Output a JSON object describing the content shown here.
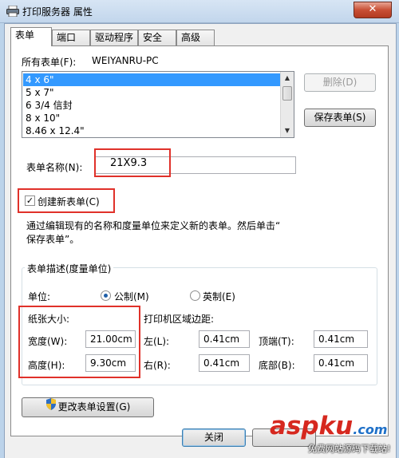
{
  "window": {
    "title": "打印服务器 属性",
    "close": "✕"
  },
  "tabs": [
    "表单",
    "端口",
    "驱动程序",
    "安全",
    "高级"
  ],
  "forms": {
    "all_forms_label": "所有表单(F):",
    "server_name": "WEIYANRU-PC",
    "list": [
      "4 x 6\"",
      "5 x 7\"",
      "6 3/4 信封",
      "8 x 10\"",
      "8.46 x 12.4\""
    ],
    "selected_index": 0
  },
  "buttons": {
    "delete": "删除(D)",
    "save_form": "保存表单(S)",
    "change_settings": "更改表单设置(G)",
    "close": "关闭"
  },
  "form_name": {
    "label": "表单名称(N):",
    "value": "21X9.3"
  },
  "create_new": {
    "label": "创建新表单(C)",
    "checked": true,
    "mark": "✓"
  },
  "instruction": "通过编辑现有的名称和度量单位来定义新的表单。然后单击“\n保存表单”。",
  "description": {
    "legend": "表单描述(度量单位)",
    "unit_label": "单位:",
    "metric": "公制(M)",
    "imperial": "英制(E)",
    "paper_size_label": "纸张大小:",
    "width_label": "宽度(W):",
    "width_value": "21.00cm",
    "height_label": "高度(H):",
    "height_value": "9.30cm",
    "margins_label": "打印机区域边距:",
    "left_label": "左(L):",
    "left_value": "0.41cm",
    "right_label": "右(R):",
    "right_value": "0.41cm",
    "top_label": "顶端(T):",
    "top_value": "0.41cm",
    "bottom_label": "底部(B):",
    "bottom_value": "0.41cm"
  },
  "watermark": {
    "brand": "aspku",
    "tld": ".com",
    "tagline": "免费网站源码下载站!"
  },
  "colors": {
    "highlight": "#e0312a",
    "selection": "#3399ff",
    "brand_red": "#d6281f",
    "brand_blue": "#1e70c8"
  }
}
